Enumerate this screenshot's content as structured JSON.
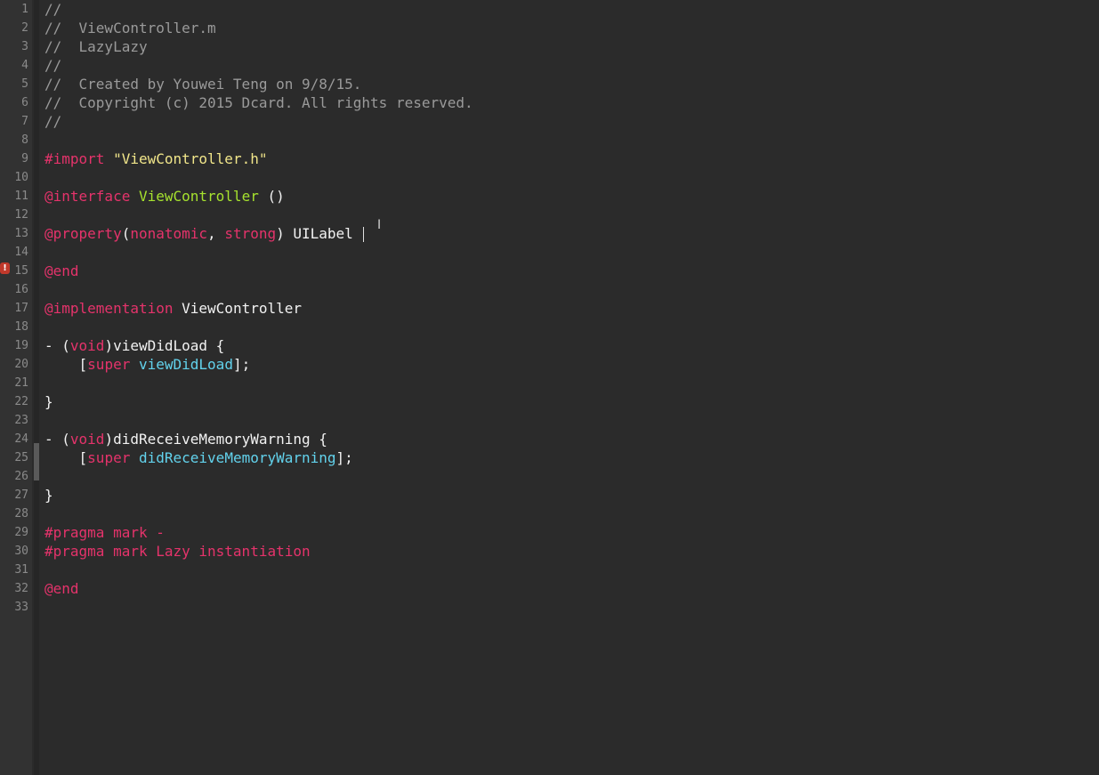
{
  "editor": {
    "line_numbers": [
      "1",
      "2",
      "3",
      "4",
      "5",
      "6",
      "7",
      "8",
      "9",
      "10",
      "11",
      "12",
      "13",
      "14",
      "15",
      "16",
      "17",
      "18",
      "19",
      "20",
      "21",
      "22",
      "23",
      "24",
      "25",
      "26",
      "27",
      "28",
      "29",
      "30",
      "31",
      "32",
      "33"
    ],
    "error_line": "15",
    "error_marker_glyph": "!",
    "lines": {
      "l1": "//",
      "l2": "//  ViewController.m",
      "l3": "//  LazyLazy",
      "l4": "//",
      "l5": "//  Created by Youwei Teng on 9/8/15.",
      "l6": "//  Copyright (c) 2015 Dcard. All rights reserved.",
      "l7": "//",
      "l9_import": "#import",
      "l9_string": "\"ViewController.h\"",
      "l11_kw": "@interface",
      "l11_class": "ViewController",
      "l11_rest": " ()",
      "l13_kw": "@property",
      "l13_paren_open": "(",
      "l13_attr1": "nonatomic",
      "l13_comma": ", ",
      "l13_attr2": "strong",
      "l13_paren_close": ") ",
      "l13_type": "UILabel",
      "l15_kw": "@end",
      "l17_kw": "@implementation",
      "l17_class": "ViewController",
      "l19_dash": "- (",
      "l19_void": "void",
      "l19_rest": ")viewDidLoad {",
      "l20_indent": "    [",
      "l20_super": "super",
      "l20_method": "viewDidLoad",
      "l20_end": "];",
      "l22": "}",
      "l24_dash": "- (",
      "l24_void": "void",
      "l24_rest": ")didReceiveMemoryWarning {",
      "l25_indent": "    [",
      "l25_super": "super",
      "l25_method": "didReceiveMemoryWarning",
      "l25_end": "];",
      "l27": "}",
      "l29": "#pragma mark -",
      "l30": "#pragma mark Lazy instantiation",
      "l32_kw": "@end"
    }
  },
  "colors": {
    "background": "#2b2b2b",
    "gutter": "#323232",
    "comment": "#9a9a9a",
    "keyword": "#e5336b",
    "string": "#f1e68a",
    "class_name": "#a6e22e",
    "method": "#62d2ec",
    "error": "#c0392b"
  },
  "icons": {
    "error": "error-badge-icon",
    "cursor": "ibeam-cursor-icon"
  }
}
